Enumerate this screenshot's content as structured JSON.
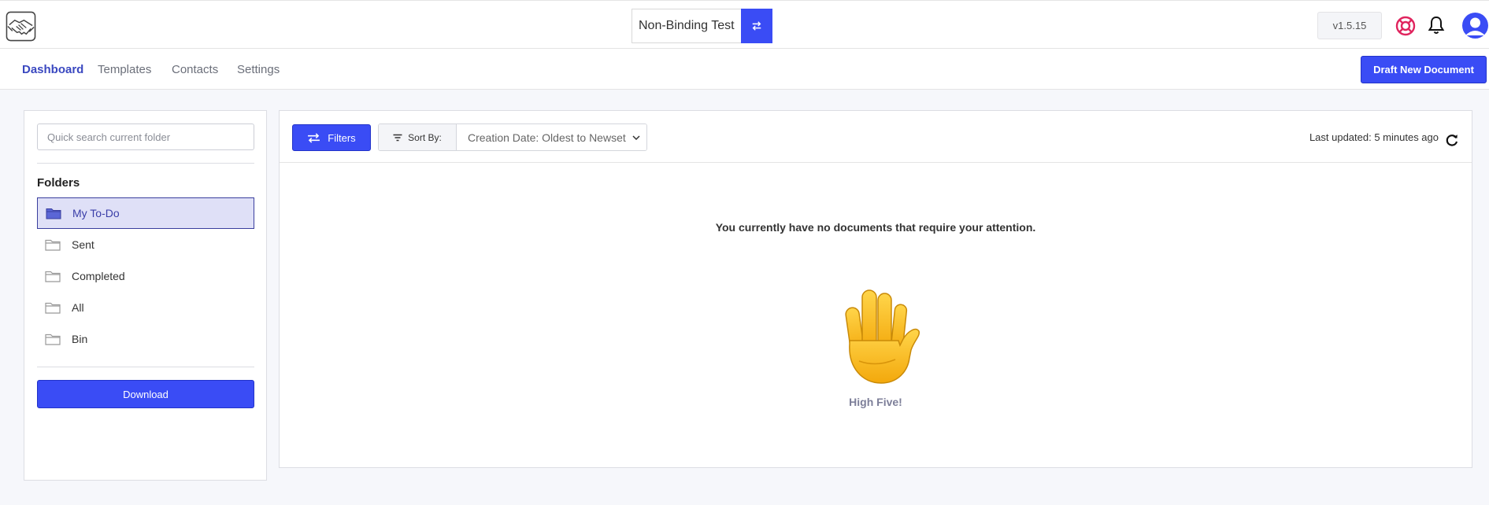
{
  "workspace": {
    "name": "Non-Binding Test"
  },
  "version": "v1.5.15",
  "nav": {
    "items": [
      "Dashboard",
      "Templates",
      "Contacts",
      "Settings"
    ],
    "active": "Dashboard",
    "draft_label": "Draft New Document"
  },
  "sidebar": {
    "search_placeholder": "Quick search current folder",
    "folders_heading": "Folders",
    "folders": [
      "My To-Do",
      "Sent",
      "Completed",
      "All",
      "Bin"
    ],
    "active_folder": "My To-Do",
    "download_label": "Download"
  },
  "toolbar": {
    "filters_label": "Filters",
    "sort_label": "Sort By:",
    "sort_value": "Creation Date: Oldest to Newset",
    "last_updated": "Last updated: 5 minutes ago"
  },
  "empty": {
    "message": "You currently have no documents that require your attention.",
    "tagline": "High Five!",
    "emoji": "raised-hand"
  },
  "colors": {
    "accent": "#3a4cf5",
    "nav_active": "#3a48c0",
    "help": "#e0245e"
  }
}
